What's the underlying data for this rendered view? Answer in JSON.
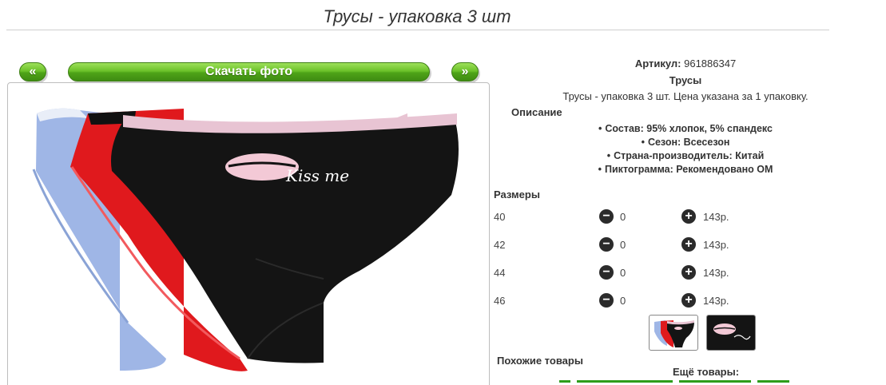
{
  "page": {
    "title": "Трусы - упаковка 3 шт"
  },
  "gallery": {
    "prev_label": "«",
    "next_label": "»",
    "download_label": "Скачать фото",
    "photo_text": "Kiss me"
  },
  "product": {
    "article_label": "Артикул:",
    "article_value": "961886347",
    "category": "Трусы",
    "summary": "Трусы - упаковка 3 шт. Цена указана за 1 упаковку.",
    "description_heading": "Описание",
    "attributes": [
      "Состав: 95% хлопок, 5% спандекс",
      "Сезон: Всесезон",
      "Страна-производитель: Китай",
      "Пиктограмма: Рекомендовано ОМ"
    ]
  },
  "sizes": {
    "heading": "Размеры",
    "rows": [
      {
        "size": "40",
        "qty": "0",
        "price": "143р."
      },
      {
        "size": "42",
        "qty": "0",
        "price": "143р."
      },
      {
        "size": "44",
        "qty": "0",
        "price": "143р."
      },
      {
        "size": "46",
        "qty": "0",
        "price": "143р."
      }
    ]
  },
  "footer": {
    "similar_label": "Похожие товары",
    "more_label": "Ещё товары:"
  },
  "colors": {
    "button_green": "#5cb521",
    "link_green": "#2e9d1a",
    "fabric_black": "#141414",
    "fabric_red": "#e0191d",
    "fabric_blue": "#9fb6e6",
    "trim_pink": "#e8c4d3"
  }
}
